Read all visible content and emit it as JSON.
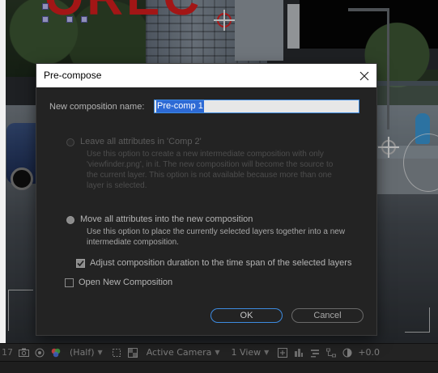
{
  "viewer": {
    "overlay_text": "OREC",
    "toolbar": {
      "frame_readout": "17",
      "resolution": "(Half)",
      "camera": "Active Camera",
      "views": "1 View",
      "exposure": "+0.0"
    }
  },
  "dialog": {
    "title": "Pre-compose",
    "name_label": "New composition name:",
    "name_value": "Pre-comp 1",
    "option_leave": {
      "label": "Leave all attributes in 'Comp 2'",
      "description": "Use this option to create a new intermediate composition with only\n'viewfinder.png', in it. The new composition will become the source to\nthe current layer. This option is not available because more than one\nlayer is selected.",
      "enabled": false,
      "selected": false
    },
    "option_move": {
      "label": "Move all attributes into the new composition",
      "description": "Use this option to place the currently selected layers together into a new\nintermediate composition.",
      "enabled": true,
      "selected": true
    },
    "adjust_duration": {
      "label": "Adjust composition duration to the time span of the selected layers",
      "checked": true
    },
    "open_new": {
      "label": "Open New Composition",
      "checked": false
    },
    "ok_label": "OK",
    "cancel_label": "Cancel"
  },
  "colors": {
    "accent": "#3d8be0",
    "selection": "#2d6ad5",
    "dialog_bg": "#232323"
  }
}
